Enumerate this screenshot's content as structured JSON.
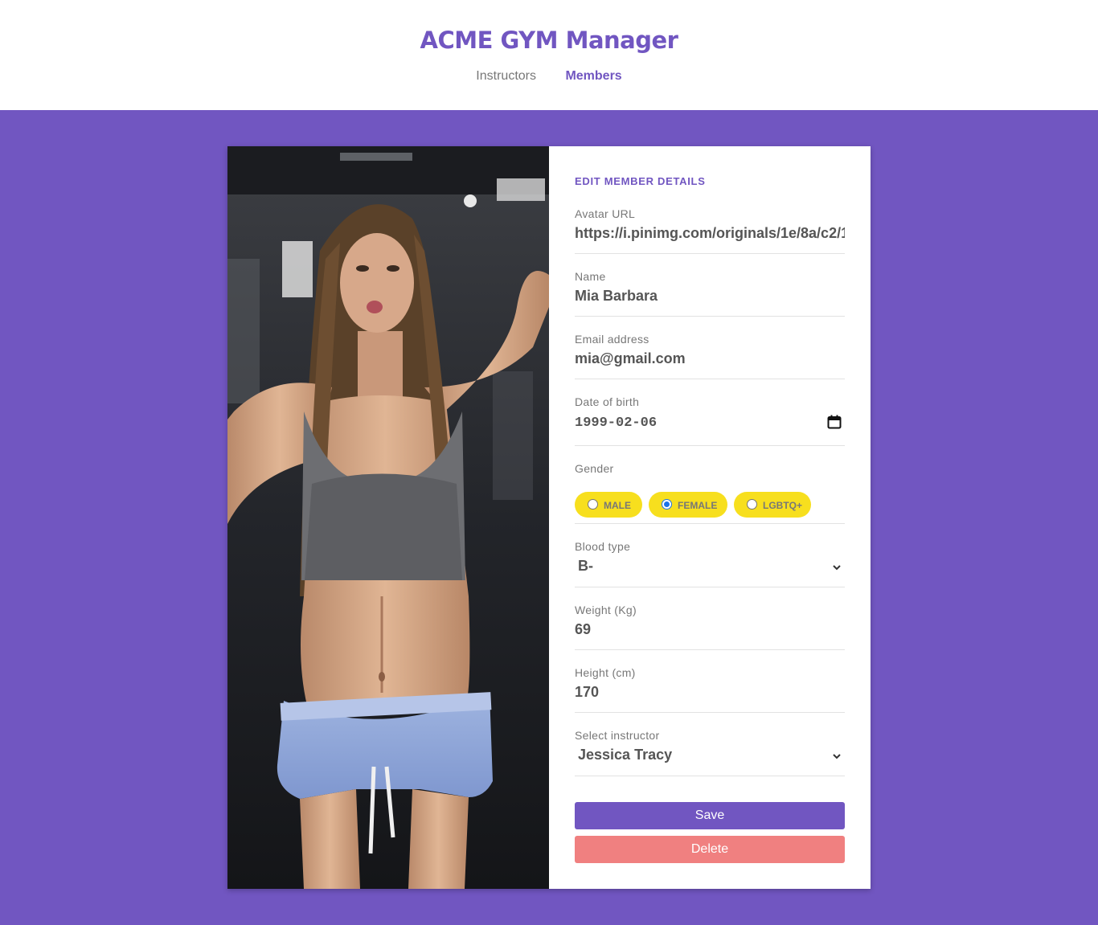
{
  "app": {
    "title": "ACME GYM Manager"
  },
  "nav": {
    "instructors": "Instructors",
    "members": "Members"
  },
  "colors": {
    "accent": "#7156c1",
    "pill": "#f7df1e",
    "delete": "#f08080",
    "background": "#7156c1"
  },
  "form": {
    "heading": "EDIT MEMBER DETAILS",
    "avatar": {
      "label": "Avatar URL",
      "value": "https://i.pinimg.com/originals/1e/8a/c2/1"
    },
    "name": {
      "label": "Name",
      "value": "Mia Barbara"
    },
    "email": {
      "label": "Email address",
      "value": "mia@gmail.com"
    },
    "birth": {
      "label": "Date of birth",
      "value": "1999-02-06",
      "icon": "calendar-icon"
    },
    "gender": {
      "label": "Gender",
      "options": [
        {
          "label": "MALE",
          "checked": false
        },
        {
          "label": "FEMALE",
          "checked": true
        },
        {
          "label": "LGBTQ+",
          "checked": false
        }
      ]
    },
    "blood": {
      "label": "Blood type",
      "value": "B-"
    },
    "weight": {
      "label": "Weight (Kg)",
      "value": "69"
    },
    "height": {
      "label": "Height (cm)",
      "value": "170"
    },
    "instructor": {
      "label": "Select instructor",
      "value": "Jessica Tracy"
    },
    "save_label": "Save",
    "delete_label": "Delete"
  }
}
